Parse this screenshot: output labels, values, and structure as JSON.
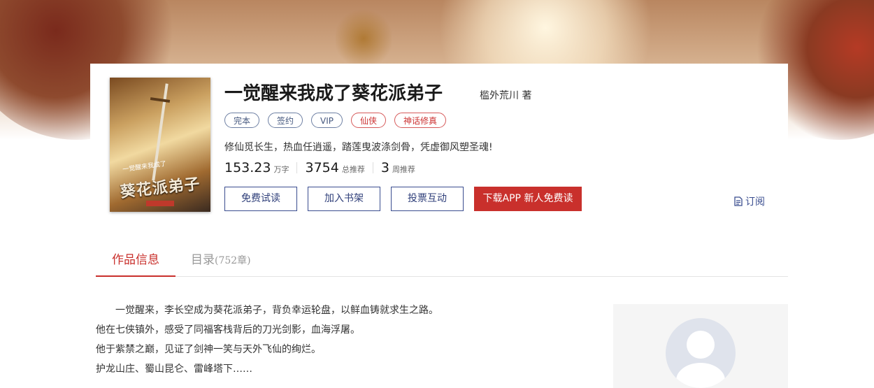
{
  "book": {
    "title": "一觉醒来我成了葵花派弟子",
    "author": "槛外荒川 著",
    "cover_title": "葵花派弟子",
    "cover_subtitle": "一觉醒来我成了",
    "tags": [
      {
        "label": "完本",
        "style": "blue"
      },
      {
        "label": "签约",
        "style": "blue"
      },
      {
        "label": "VIP",
        "style": "blue"
      },
      {
        "label": "仙侠",
        "style": "red"
      },
      {
        "label": "神话修真",
        "style": "red"
      }
    ],
    "intro": "修仙觅长生，热血任逍遥，踏莲曳波涤剑骨，凭虚御风塑圣魂!",
    "stats": [
      {
        "num": "153.23",
        "unit": "万字"
      },
      {
        "num": "3754",
        "unit": "总推荐"
      },
      {
        "num": "3",
        "unit": "周推荐"
      }
    ]
  },
  "actions": {
    "free_read": "免费试读",
    "add_shelf": "加入书架",
    "vote": "投票互动",
    "download": "下载APP 新人免费读",
    "subscribe": "订阅"
  },
  "tabs": {
    "info": "作品信息",
    "catalog": "目录",
    "catalog_count": "(752章)"
  },
  "description": [
    "　　一觉醒来，李长空成为葵花派弟子，背负幸运轮盘，以鲜血铸就求生之路。",
    "他在七侠镇外，感受了同福客栈背后的刀光剑影，血海浮屠。",
    "他于紫禁之巅，见证了剑神一笑与天外飞仙的绚烂。",
    "护龙山庄、蜀山昆仑、雷峰塔下……"
  ],
  "colors": {
    "accent_red": "#c9302c",
    "accent_blue": "#3a4d8f"
  }
}
